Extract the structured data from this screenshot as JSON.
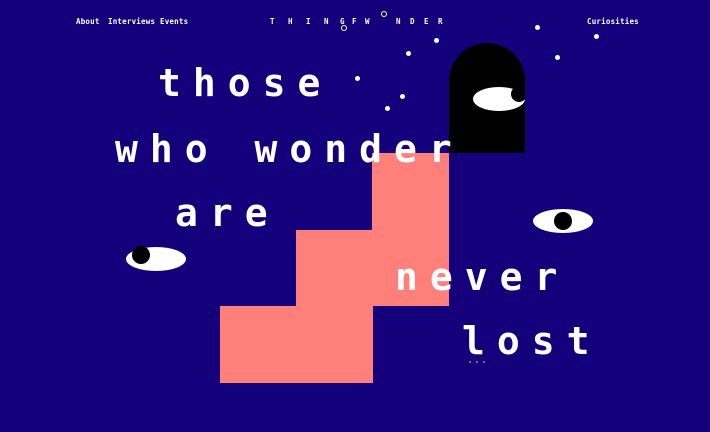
{
  "nav": {
    "left": [
      "About",
      "Interviews",
      "Events"
    ],
    "right": "Curiosities"
  },
  "brand": {
    "letters": [
      "T",
      "H",
      "I",
      "N",
      "G",
      "O",
      "F",
      "W",
      "O",
      "N",
      "D",
      "E",
      "R"
    ]
  },
  "headline": {
    "line1": "those",
    "line2": "who wonder",
    "line3": "are",
    "line4": "never",
    "line5": "lost"
  },
  "colors": {
    "background": "#14007a",
    "accent": "#ff7f7b",
    "black": "#000000",
    "white": "#ffffff"
  },
  "icons": [
    "eye-icon",
    "arch-door-icon",
    "star-dot-icon"
  ]
}
